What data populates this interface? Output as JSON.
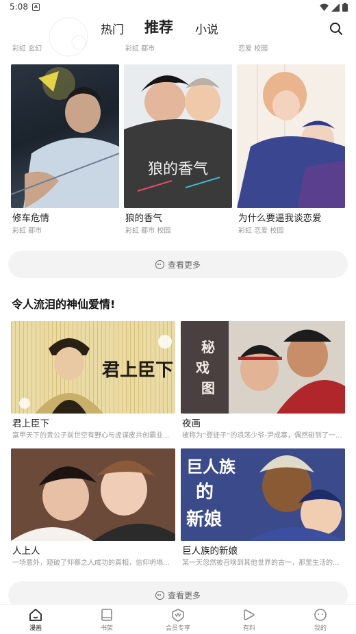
{
  "status": {
    "time": "5:08",
    "notif_glyph": "A"
  },
  "nav": {
    "tabs": [
      {
        "label": "热门",
        "active": false
      },
      {
        "label": "推荐",
        "active": true
      },
      {
        "label": "小说",
        "active": false
      }
    ]
  },
  "prev_row_tags": [
    "彩虹 玄幻",
    "彩虹 都市",
    "恋爱 校园"
  ],
  "grid_cards": [
    {
      "title": "修车危情",
      "tags": "彩虹 都市",
      "cover_colors": [
        "#1e2a36",
        "#c9d3e0"
      ]
    },
    {
      "title": "狼的香气",
      "tags": "彩虹 都市 校园",
      "cover_colors": [
        "#2a2a2a",
        "#d94b5a"
      ]
    },
    {
      "title": "为什么要逼我谈恋爱",
      "tags": "彩虹 恋爱 校园",
      "cover_colors": [
        "#f3d9d1",
        "#3a3f7a"
      ]
    }
  ],
  "more_label_1": "查看更多",
  "section": {
    "title": "令人流泪的神仙爱情!",
    "cards": [
      {
        "title": "君上臣下",
        "desc": "富甲天下的贵公子前世空有野心与虎谋皮共创霸业...",
        "cover_text": "君上臣下",
        "cover_colors": [
          "#e8d59a",
          "#1f1a14"
        ]
      },
      {
        "title": "夜画",
        "desc": "被称为“登徒子”的浪荡少爷-尹成寨，偶然碰到了一...",
        "cover_text": "秘戏图",
        "cover_colors": [
          "#3a3434",
          "#b0262b"
        ]
      },
      {
        "title": "人上人",
        "desc": "一场意外，窥破了仰慕之人成功的真相，信仰坍塌...",
        "cover_text": "",
        "cover_colors": [
          "#5a3a2e",
          "#e8c8b8"
        ]
      },
      {
        "title": "巨人族的新娘",
        "desc": "某一天忽然被召唤到其他世界的古一，那里生活的...",
        "cover_text": "巨人族的新娘",
        "cover_colors": [
          "#2e3a7a",
          "#c98a4a"
        ]
      }
    ]
  },
  "more_label_2": "查看更多",
  "bottom_nav": [
    {
      "label": "漫画",
      "icon": "home-icon",
      "active": true
    },
    {
      "label": "书架",
      "icon": "bookshelf-icon",
      "active": false
    },
    {
      "label": "会员专享",
      "icon": "vip-icon",
      "active": false
    },
    {
      "label": "有料",
      "icon": "play-icon",
      "active": false
    },
    {
      "label": "我的",
      "icon": "profile-icon",
      "active": false
    }
  ]
}
